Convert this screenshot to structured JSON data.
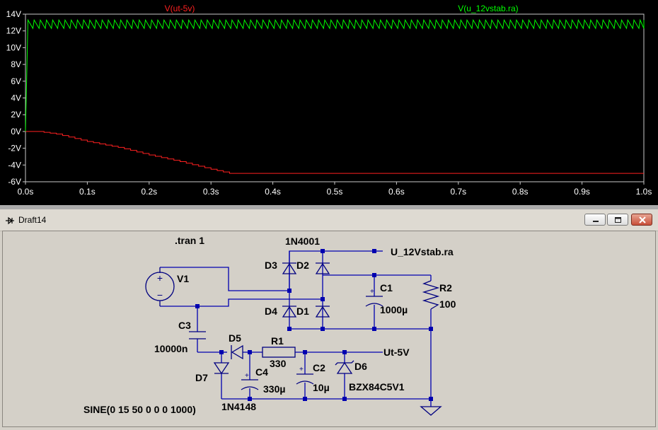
{
  "plot": {
    "traces": [
      {
        "name": "V(ut-5v)",
        "color": "#ff2020"
      },
      {
        "name": "V(u_12vstab.ra)",
        "color": "#00ff00"
      }
    ],
    "y_ticks": [
      "14V",
      "12V",
      "10V",
      "8V",
      "6V",
      "4V",
      "2V",
      "0V",
      "-2V",
      "-4V",
      "-6V"
    ],
    "x_ticks": [
      "0.0s",
      "0.1s",
      "0.2s",
      "0.3s",
      "0.4s",
      "0.5s",
      "0.6s",
      "0.7s",
      "0.8s",
      "0.9s",
      "1.0s"
    ],
    "background": "#000000",
    "grid": false
  },
  "chart_data": {
    "type": "line",
    "title": "",
    "xlabel": "",
    "ylabel": "",
    "xlim": [
      0,
      1.0
    ],
    "ylim": [
      -6,
      14
    ],
    "series": [
      {
        "name": "V(ut-5v)",
        "color": "#ff2020",
        "x": [
          0.0,
          0.02,
          0.05,
          0.1,
          0.15,
          0.2,
          0.25,
          0.3,
          0.33,
          0.4,
          0.5,
          0.6,
          0.7,
          0.8,
          0.9,
          1.0
        ],
        "y": [
          0.0,
          0.0,
          -0.3,
          -1.2,
          -1.9,
          -2.8,
          -3.6,
          -4.5,
          -5.0,
          -5.0,
          -5.0,
          -5.0,
          -5.0,
          -5.0,
          -5.0,
          -5.0
        ]
      },
      {
        "name": "V(u_12vstab.ra)",
        "color": "#00ff00",
        "ripple_min": 12.3,
        "ripple_max": 13.3,
        "ripple_period": 0.01,
        "startup": {
          "x": [
            0.0,
            0.003,
            0.004
          ],
          "y": [
            0.0,
            9.8,
            13.3
          ]
        }
      }
    ]
  },
  "window": {
    "title": "Draft14",
    "icon": "ltspice-schematic-icon",
    "buttons": [
      "minimize-icon",
      "restore-icon",
      "close-icon"
    ]
  },
  "schematic": {
    "directive": ".tran 1",
    "source_name": "V1",
    "source_value": "SINE(0 15 50 0 0 0 1000)",
    "bridge_diode_model": "1N4001",
    "d1": "D1",
    "d2": "D2",
    "d3": "D3",
    "d4": "D4",
    "net_12v": "U_12Vstab.ra",
    "c1_name": "C1",
    "c1_value": "1000µ",
    "r2_name": "R2",
    "r2_value": "100",
    "c3_name": "C3",
    "c3_value": "10000n",
    "d5_name": "D5",
    "d7_name": "D7",
    "d57_model": "1N4148",
    "r1_name": "R1",
    "r1_value": "330",
    "c4_name": "C4",
    "c4_value": "330µ",
    "c2_name": "C2",
    "c2_value": "10µ",
    "d6_name": "D6",
    "d6_model": "BZX84C5V1",
    "net_5v": "Ut-5V"
  }
}
